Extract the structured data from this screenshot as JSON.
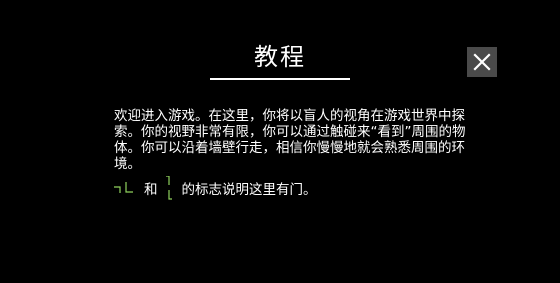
{
  "dialog": {
    "title": "教程",
    "body": "欢迎进入游戏。在这里，你将以盲人的视角在游戏世界中探索。你的视野非常有限，你可以通过触碰来“看到”周围的物体。你可以沿着墙壁行走，相信你慢慢地就会熟悉周围的环境。",
    "hint_and": "和",
    "hint_rest": "的标志说明这里有门。"
  },
  "icons": {
    "close": "close-icon",
    "door_horizontal": "door-marker-horizontal-icon",
    "door_vertical": "door-marker-vertical-icon"
  },
  "colors": {
    "background": "#000000",
    "text": "#ffffff",
    "close_button_bg": "#4a4a4a",
    "door_marker": "#8fd15e"
  }
}
